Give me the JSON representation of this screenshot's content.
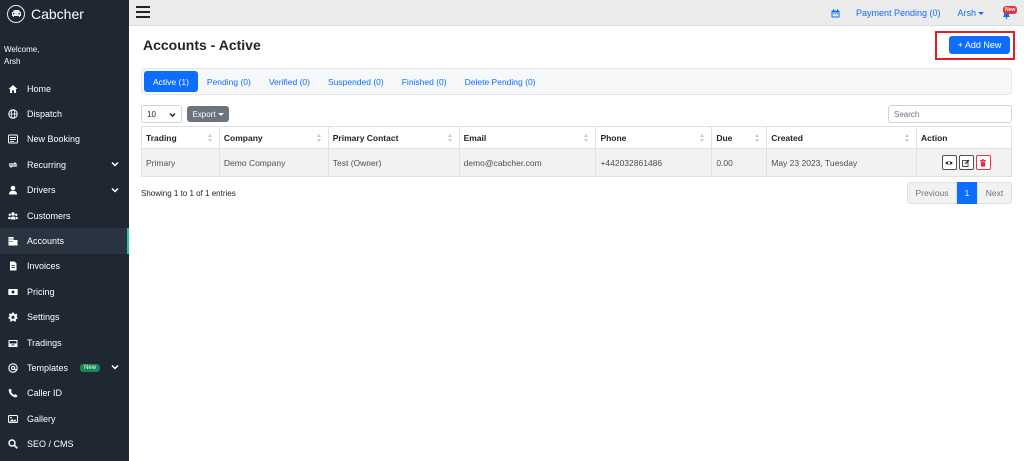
{
  "brand": {
    "name": "Cabcher"
  },
  "welcome": {
    "label": "Welcome,",
    "name": "Arsh"
  },
  "sidebar": {
    "items": [
      {
        "label": "Home",
        "icon": "home-icon"
      },
      {
        "label": "Dispatch",
        "icon": "globe-icon"
      },
      {
        "label": "New Booking",
        "icon": "list-icon"
      },
      {
        "label": "Recurring",
        "icon": "repeat-icon"
      },
      {
        "label": "Drivers",
        "icon": "user-icon"
      },
      {
        "label": "Customers",
        "icon": "users-icon"
      },
      {
        "label": "Accounts",
        "icon": "building-icon"
      },
      {
        "label": "Invoices",
        "icon": "file-icon"
      },
      {
        "label": "Pricing",
        "icon": "money-icon"
      },
      {
        "label": "Settings",
        "icon": "gear-icon"
      },
      {
        "label": "Tradings",
        "icon": "inbox-icon"
      },
      {
        "label": "Templates",
        "icon": "at-icon",
        "badge": "New"
      },
      {
        "label": "Caller ID",
        "icon": "phone-icon"
      },
      {
        "label": "Gallery",
        "icon": "image-icon"
      },
      {
        "label": "SEO / CMS",
        "icon": "search-icon"
      }
    ]
  },
  "topbar": {
    "payment_pending": "Payment Pending (0)",
    "user": "Arsh",
    "notification_badge": "New"
  },
  "page": {
    "title": "Accounts - Active",
    "add_button": "+ Add New"
  },
  "tabs": [
    {
      "label": "Active (1)",
      "active": true
    },
    {
      "label": "Pending (0)"
    },
    {
      "label": "Verified (0)"
    },
    {
      "label": "Suspended (0)"
    },
    {
      "label": "Finished (0)"
    },
    {
      "label": "Delete Pending (0)"
    }
  ],
  "controls": {
    "page_length": "10",
    "export_label": "Export",
    "search_placeholder": "Search"
  },
  "table": {
    "columns": [
      "Trading",
      "Company",
      "Primary Contact",
      "Email",
      "Phone",
      "Due",
      "Created",
      "Action"
    ],
    "rows": [
      {
        "trading": "Primary",
        "company": "Demo Company",
        "primary_contact": "Test (Owner)",
        "email": "demo@cabcher.com",
        "phone": "+442032861486",
        "due": "0.00",
        "created": "May 23 2023, Tuesday"
      }
    ]
  },
  "footer": {
    "info": "Showing 1 to 1 of 1 entries",
    "previous": "Previous",
    "current_page": "1",
    "next": "Next"
  },
  "colors": {
    "sidebar_bg": "#1f2733",
    "primary": "#0d6efd",
    "highlight": "#e31e24",
    "danger": "#dc3545"
  }
}
